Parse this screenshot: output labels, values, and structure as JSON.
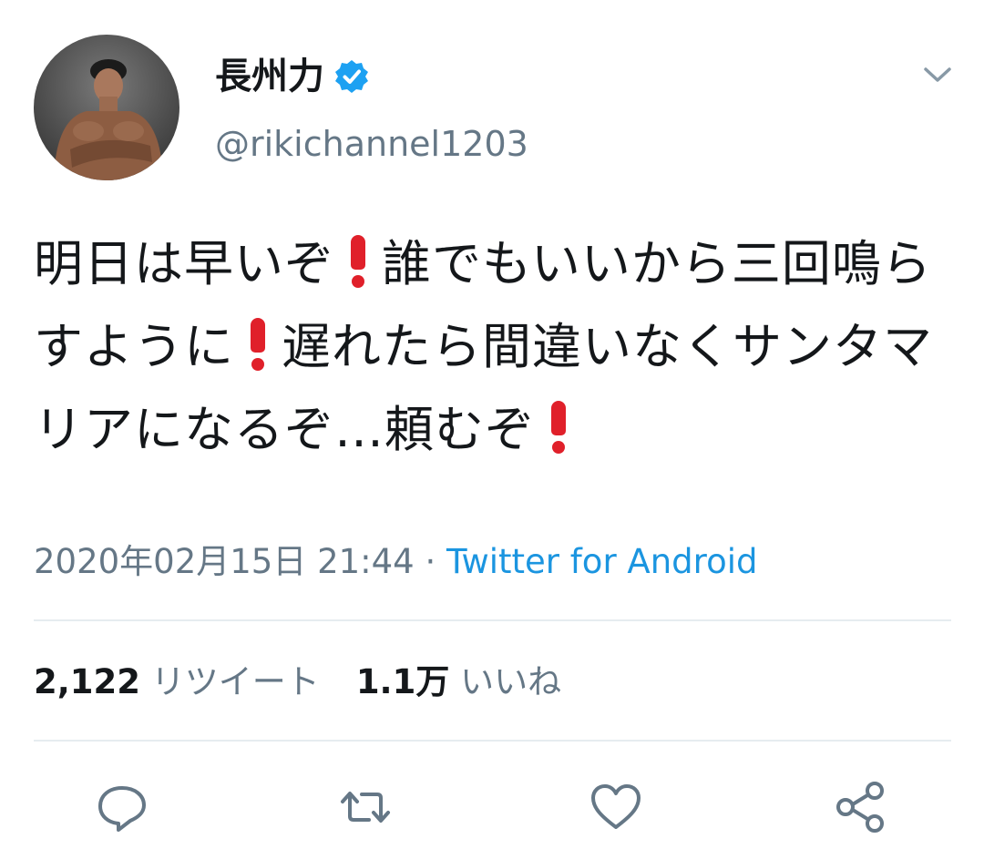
{
  "tweet": {
    "author": {
      "display_name": "長州力",
      "handle": "@rikichannel1203",
      "verified": true
    },
    "text_segments": [
      "明日は早いぞ",
      "誰でもいいから三回鳴らすように",
      "遅れたら間違いなくサンタマリアになるぞ…頼むぞ"
    ],
    "emoji": "red-exclamation-mark",
    "timestamp": "2020年02月15日 21:44",
    "separator": " · ",
    "source": "Twitter for Android",
    "stats": {
      "retweets_count": "2,122",
      "retweets_label": "リツイート",
      "likes_count": "1.1万",
      "likes_label": "いいね"
    }
  },
  "actions": [
    "reply-icon",
    "retweet-icon",
    "like-icon",
    "share-icon"
  ],
  "colors": {
    "text": "#14171a",
    "secondary": "#657786",
    "link": "#1b95e0",
    "verified": "#1da1f2",
    "divider": "#e6ecf0",
    "emoji_red": "#e0202a"
  }
}
